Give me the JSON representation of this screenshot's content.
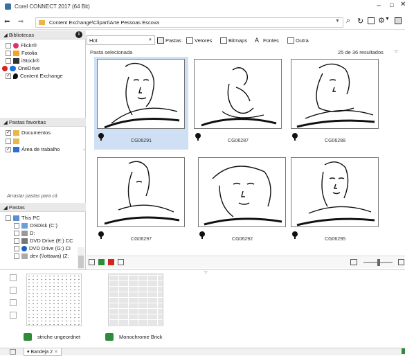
{
  "window": {
    "title": "Corel CONNECT 2017 (64 Bit)",
    "min": "–",
    "max": "□",
    "close": "✕"
  },
  "address": {
    "path": "Content Exchange\\Clipart\\Arte Pessoas Escova",
    "back_icon": "back-arrow-icon",
    "forward_icon": "forward-arrow-icon"
  },
  "libraries": {
    "header": "Bibliotecas",
    "items": [
      {
        "label": "Flickr®",
        "checked": false,
        "color": "#e1306c"
      },
      {
        "label": "Fotolia",
        "checked": false,
        "color": "#f7a51c"
      },
      {
        "label": "iStock®",
        "checked": false,
        "color": "#333333"
      },
      {
        "label": "OneDrive",
        "checked": false,
        "color": "#1e6fd9"
      },
      {
        "label": "Content Exchange",
        "checked": true,
        "color": "#111111"
      }
    ]
  },
  "favorites": {
    "header": "Pastas favoritas",
    "items": [
      {
        "label": "Documentos",
        "checked": true
      },
      {
        "label": "",
        "checked": false
      },
      {
        "label": "Área de trabalho",
        "checked": true
      }
    ],
    "drag_hint": "Arrastar pastas para cá"
  },
  "folders": {
    "header": "Pastas",
    "items": [
      {
        "label": "This PC",
        "indent": 0
      },
      {
        "label": "OSDisk (C:)",
        "indent": 1
      },
      {
        "label": "D:",
        "indent": 1
      },
      {
        "label": "DVD Drive (E:) CC",
        "indent": 1
      },
      {
        "label": "DVD Drive (G:) CI",
        "indent": 1
      },
      {
        "label": "dev (\\\\ottawa) (Z:",
        "indent": 1
      }
    ]
  },
  "toolbar": {
    "filter_value": "Hot",
    "chips": [
      {
        "label": "Pastas"
      },
      {
        "label": "Vetores"
      },
      {
        "label": "Bitmaps"
      },
      {
        "label": "Fontes"
      },
      {
        "label": "Outra"
      }
    ]
  },
  "results": {
    "selected_label": "Pasta selecionada",
    "count_text": "25 de 36 resultados",
    "tiles": [
      {
        "id": "CG06291",
        "selected": true
      },
      {
        "id": "CG06287",
        "selected": false
      },
      {
        "id": "CG06288",
        "selected": false
      },
      {
        "id": "CG06297",
        "selected": false
      },
      {
        "id": "CG06292",
        "selected": false
      },
      {
        "id": "CG06295",
        "selected": false
      }
    ]
  },
  "tray": {
    "items": [
      {
        "label": "striche ungeordnet"
      },
      {
        "label": "Monochrome Brick"
      }
    ],
    "tab_label": "Bandeja 2"
  }
}
